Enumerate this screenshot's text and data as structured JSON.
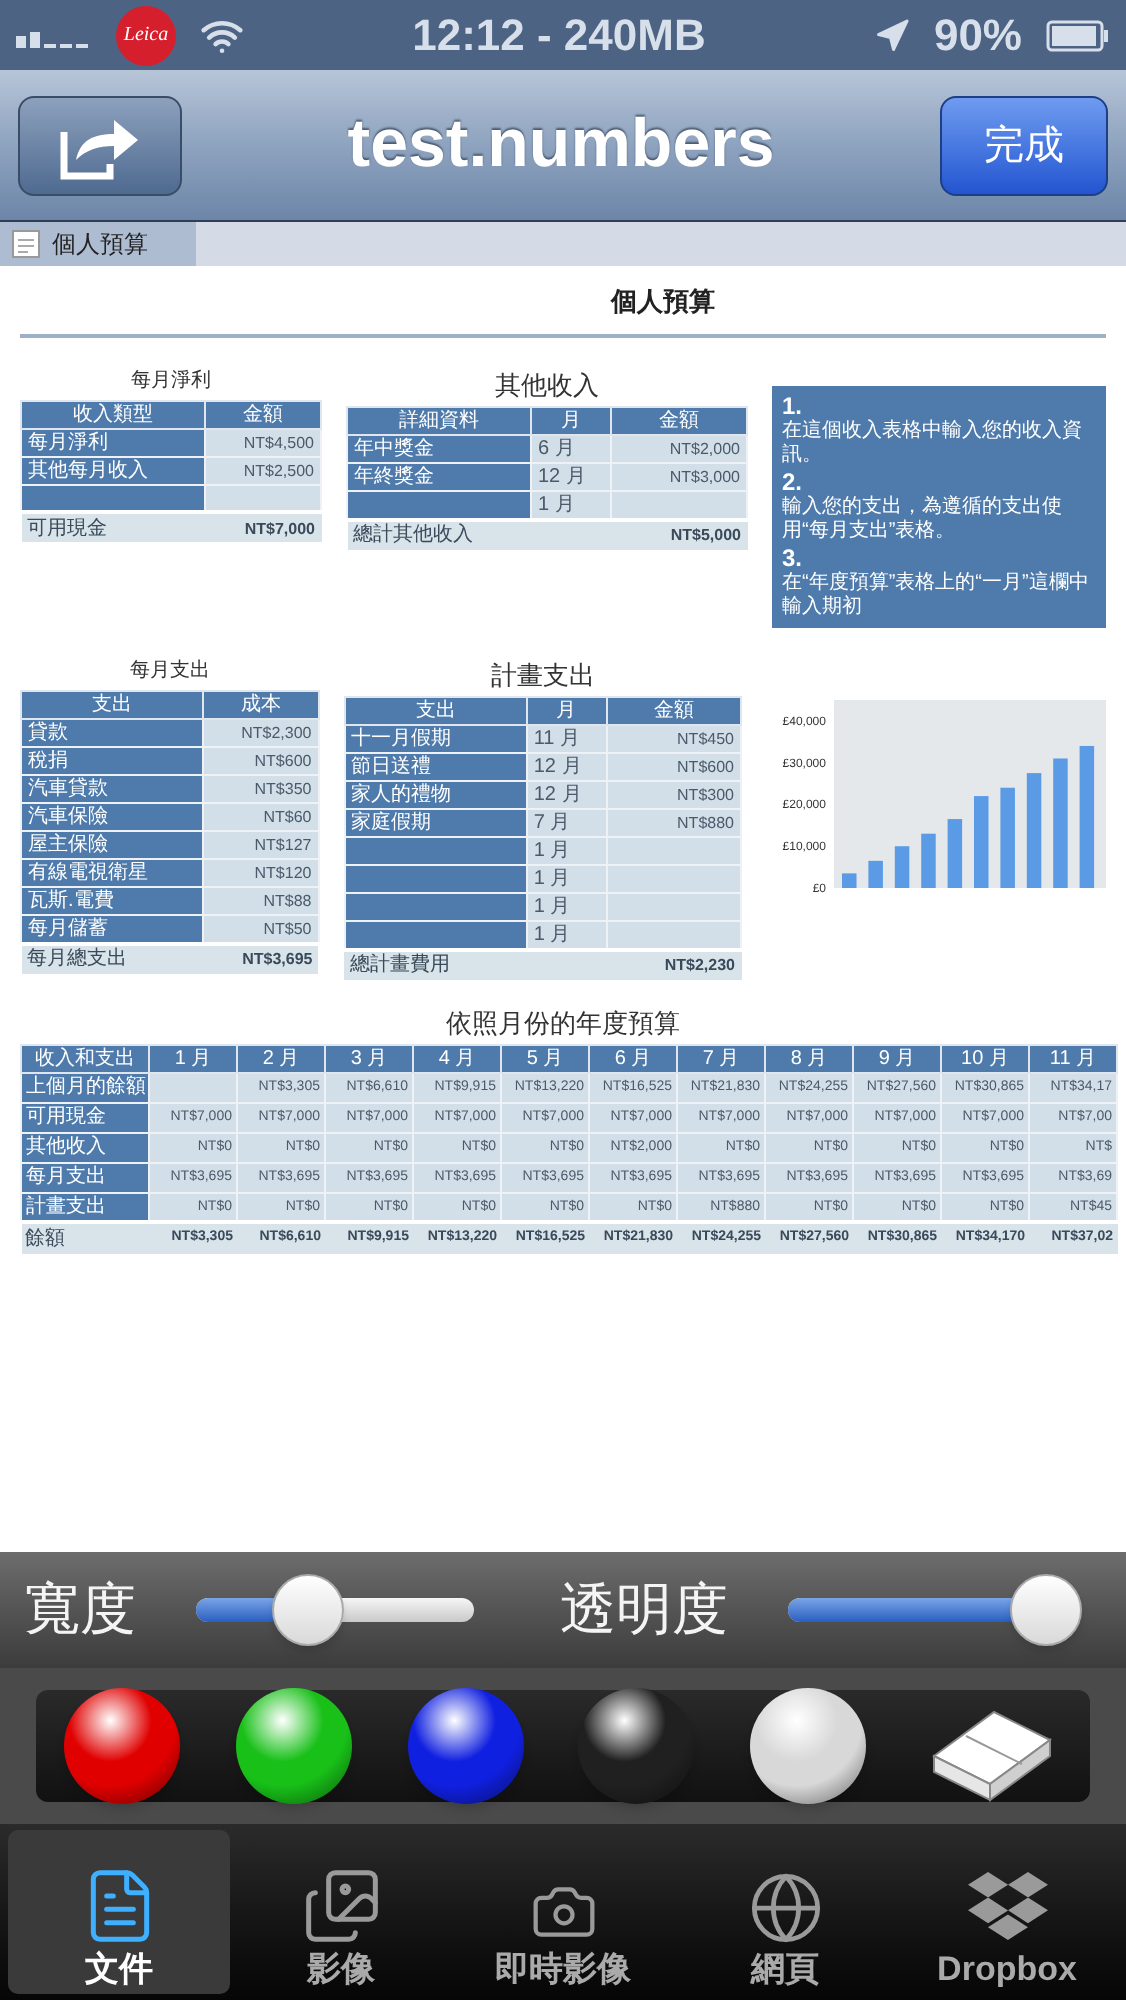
{
  "status_bar": {
    "logo": "Leica",
    "time": "12:12 - 240MB",
    "battery": "90%"
  },
  "nav_bar": {
    "title": "test.numbers",
    "done_button": "完成"
  },
  "sheet_tabs": [
    {
      "label": "個人預算",
      "selected": true
    }
  ],
  "sheet": {
    "title": "個人預算",
    "tables": [
      {
        "title": "每月淨利",
        "columns": [
          "收入類型",
          "金額"
        ],
        "rows": [
          [
            "每月淨利",
            "NT$4,500"
          ],
          [
            "其他每月收入",
            "NT$2,500"
          ],
          [
            null,
            null
          ]
        ],
        "footer": {
          "label": "可用現金",
          "total": "NT$7,000"
        }
      },
      {
        "title": "其他收入",
        "columns": [
          "詳細資料",
          "月",
          "金額"
        ],
        "rows": [
          [
            "年中獎金",
            "6 月",
            "NT$2,000"
          ],
          [
            "年終獎金",
            "12 月",
            "NT$3,000"
          ],
          [
            null,
            "1 月",
            null
          ]
        ],
        "footer": {
          "label": "總計其他收入",
          "total": "NT$5,000"
        }
      },
      {
        "title": "每月支出",
        "columns": [
          "支出",
          "成本"
        ],
        "rows": [
          [
            "貸款",
            "NT$2,300"
          ],
          [
            "稅捐",
            "NT$600"
          ],
          [
            "汽車貸款",
            "NT$350"
          ],
          [
            "汽車保險",
            "NT$60"
          ],
          [
            "屋主保險",
            "NT$127"
          ],
          [
            "有線電視衛星",
            "NT$120"
          ],
          [
            "瓦斯.電費",
            "NT$88"
          ],
          [
            "每月儲蓄",
            "NT$50"
          ]
        ],
        "footer": {
          "label": "每月總支出",
          "total": "NT$3,695"
        }
      },
      {
        "title": "計畫支出",
        "columns": [
          "支出",
          "月",
          "金額"
        ],
        "rows": [
          [
            "十一月假期",
            "11 月",
            "NT$450"
          ],
          [
            "節日送禮",
            "12 月",
            "NT$600"
          ],
          [
            "家人的禮物",
            "12 月",
            "NT$300"
          ],
          [
            "家庭假期",
            "7 月",
            "NT$880"
          ],
          [
            null,
            "1 月",
            null
          ],
          [
            null,
            "1 月",
            null
          ],
          [
            null,
            "1 月",
            null
          ],
          [
            null,
            "1 月",
            null
          ]
        ],
        "footer": {
          "label": "總計畫費用",
          "total": "NT$2,230"
        }
      }
    ],
    "instructions": [
      {
        "number": "1.",
        "text": "在這個收入表格中輸入您的收入資訊。"
      },
      {
        "number": "2.",
        "text": "輸入您的支出，為遵循的支出使用“每月支出”表格。"
      },
      {
        "number": "3.",
        "text": "在“年度預算”表格上的“一月”這欄中輸入期初"
      }
    ],
    "chart": {
      "chart_data": {
        "type": "bar",
        "categories": [
          null,
          null,
          null,
          null,
          null,
          null,
          null,
          null,
          null,
          null
        ],
        "ylim": [
          0,
          45000
        ],
        "yticks": [
          {
            "value": 0,
            "label": "£0"
          },
          {
            "value": 10000,
            "label": "£10,000"
          },
          {
            "value": 20000,
            "label": "£20,000"
          },
          {
            "value": 30000,
            "label": "£30,000"
          },
          {
            "value": 40000,
            "label": "£40,000"
          }
        ],
        "series": [
          {
            "color": "#5b9be6",
            "values": [
              3500,
              6500,
              10000,
              13000,
              16500,
              22000,
              24000,
              27500,
              31000,
              34000
            ]
          }
        ]
      }
    },
    "annual": {
      "title": "依照月份的年度預算",
      "columns": [
        "收入和支出",
        "1 月",
        "2 月",
        "3 月",
        "4 月",
        "5 月",
        "6 月",
        "7 月",
        "8 月",
        "9 月",
        "10 月",
        "11 月"
      ],
      "rows": [
        [
          "上個月的餘額",
          null,
          "NT$3,305",
          "NT$6,610",
          "NT$9,915",
          "NT$13,220",
          "NT$16,525",
          "NT$21,830",
          "NT$24,255",
          "NT$27,560",
          "NT$30,865",
          "NT$34,17"
        ],
        [
          "可用現金",
          "NT$7,000",
          "NT$7,000",
          "NT$7,000",
          "NT$7,000",
          "NT$7,000",
          "NT$7,000",
          "NT$7,000",
          "NT$7,000",
          "NT$7,000",
          "NT$7,000",
          "NT$7,00"
        ],
        [
          "其他收入",
          "NT$0",
          "NT$0",
          "NT$0",
          "NT$0",
          "NT$0",
          "NT$2,000",
          "NT$0",
          "NT$0",
          "NT$0",
          "NT$0",
          "NT$"
        ],
        [
          "每月支出",
          "NT$3,695",
          "NT$3,695",
          "NT$3,695",
          "NT$3,695",
          "NT$3,695",
          "NT$3,695",
          "NT$3,695",
          "NT$3,695",
          "NT$3,695",
          "NT$3,695",
          "NT$3,69"
        ],
        [
          "計畫支出",
          "NT$0",
          "NT$0",
          "NT$0",
          "NT$0",
          "NT$0",
          "NT$0",
          "NT$880",
          "NT$0",
          "NT$0",
          "NT$0",
          "NT$45"
        ]
      ],
      "footer": [
        "餘額",
        "NT$3,305",
        "NT$6,610",
        "NT$9,915",
        "NT$13,220",
        "NT$16,525",
        "NT$21,830",
        "NT$24,255",
        "NT$27,560",
        "NT$30,865",
        "NT$34,170",
        "NT$37,02"
      ]
    }
  },
  "pen_settings": {
    "width": {
      "label": "寬度",
      "level": 0.4
    },
    "opacity": {
      "label": "透明度",
      "level": 0.93
    }
  },
  "colors": [
    {
      "kind": "ball",
      "color": "#e00000",
      "selected": false
    },
    {
      "kind": "ball",
      "color": "#18c018",
      "selected": false
    },
    {
      "kind": "ball",
      "color": "#1020e0",
      "selected": false
    },
    {
      "kind": "ball",
      "color": "#202020",
      "selected": false
    },
    {
      "kind": "ball",
      "color": "#d8d8d8",
      "selected": false
    },
    {
      "kind": "eraser",
      "selected": false
    }
  ],
  "tab_bar": [
    {
      "label": "文件",
      "selected": true
    },
    {
      "label": "影像",
      "selected": false
    },
    {
      "label": "即時影像",
      "selected": false
    },
    {
      "label": "網頁",
      "selected": false
    },
    {
      "label": "Dropbox",
      "selected": false
    }
  ]
}
